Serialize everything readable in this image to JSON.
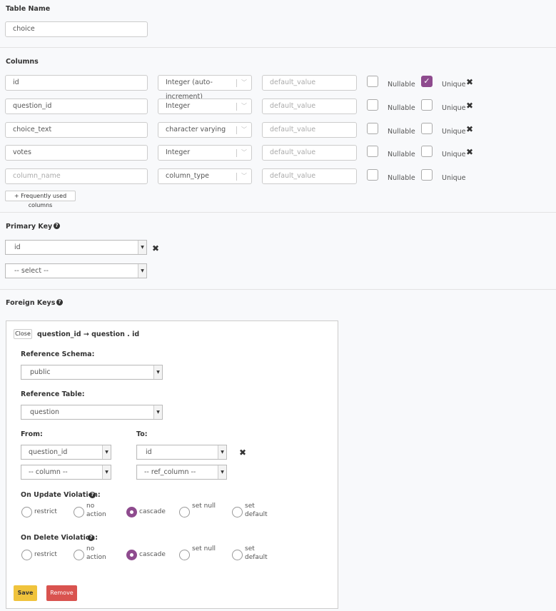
{
  "table_name": {
    "label": "Table Name",
    "value": "choice"
  },
  "columns": {
    "label": "Columns",
    "nullable_label": "Nullable",
    "unique_label": "Unique",
    "rows": [
      {
        "name": "id",
        "type": "Integer (auto-increment)",
        "default_placeholder": "default_value",
        "nullable": false,
        "unique": true
      },
      {
        "name": "question_id",
        "type": "Integer",
        "default_placeholder": "default_value",
        "nullable": false,
        "unique": false
      },
      {
        "name": "choice_text",
        "type": "character varying",
        "default_placeholder": "default_value",
        "nullable": false,
        "unique": false
      },
      {
        "name": "votes",
        "type": "Integer",
        "default_placeholder": "default_value",
        "nullable": false,
        "unique": false
      },
      {
        "name_placeholder": "column_name",
        "type_placeholder": "column_type",
        "default_placeholder": "default_value",
        "nullable": false,
        "unique": false
      }
    ],
    "frequent_button": "+ Frequently used columns"
  },
  "primary_key": {
    "label": "Primary Key",
    "selected": "id",
    "placeholder": "-- select --"
  },
  "foreign_keys": {
    "label": "Foreign Keys",
    "close_label": "Close",
    "title": "question_id → question . id",
    "ref_schema_label": "Reference Schema:",
    "ref_schema": "public",
    "ref_table_label": "Reference Table:",
    "ref_table": "question",
    "from_label": "From:",
    "to_label": "To:",
    "from": "question_id",
    "to": "id",
    "from_placeholder": "-- column --",
    "to_placeholder": "-- ref_column --",
    "on_update_label": "On Update Violation:",
    "on_delete_label": "On Delete Violation:",
    "options": [
      "restrict",
      "no action",
      "cascade",
      "set null",
      "set default"
    ],
    "on_update": "cascade",
    "on_delete": "cascade",
    "save_label": "Save",
    "remove_label": "Remove"
  },
  "colors": {
    "accent": "#8e4b8e",
    "save": "#f0c33c",
    "remove": "#d9534f"
  }
}
